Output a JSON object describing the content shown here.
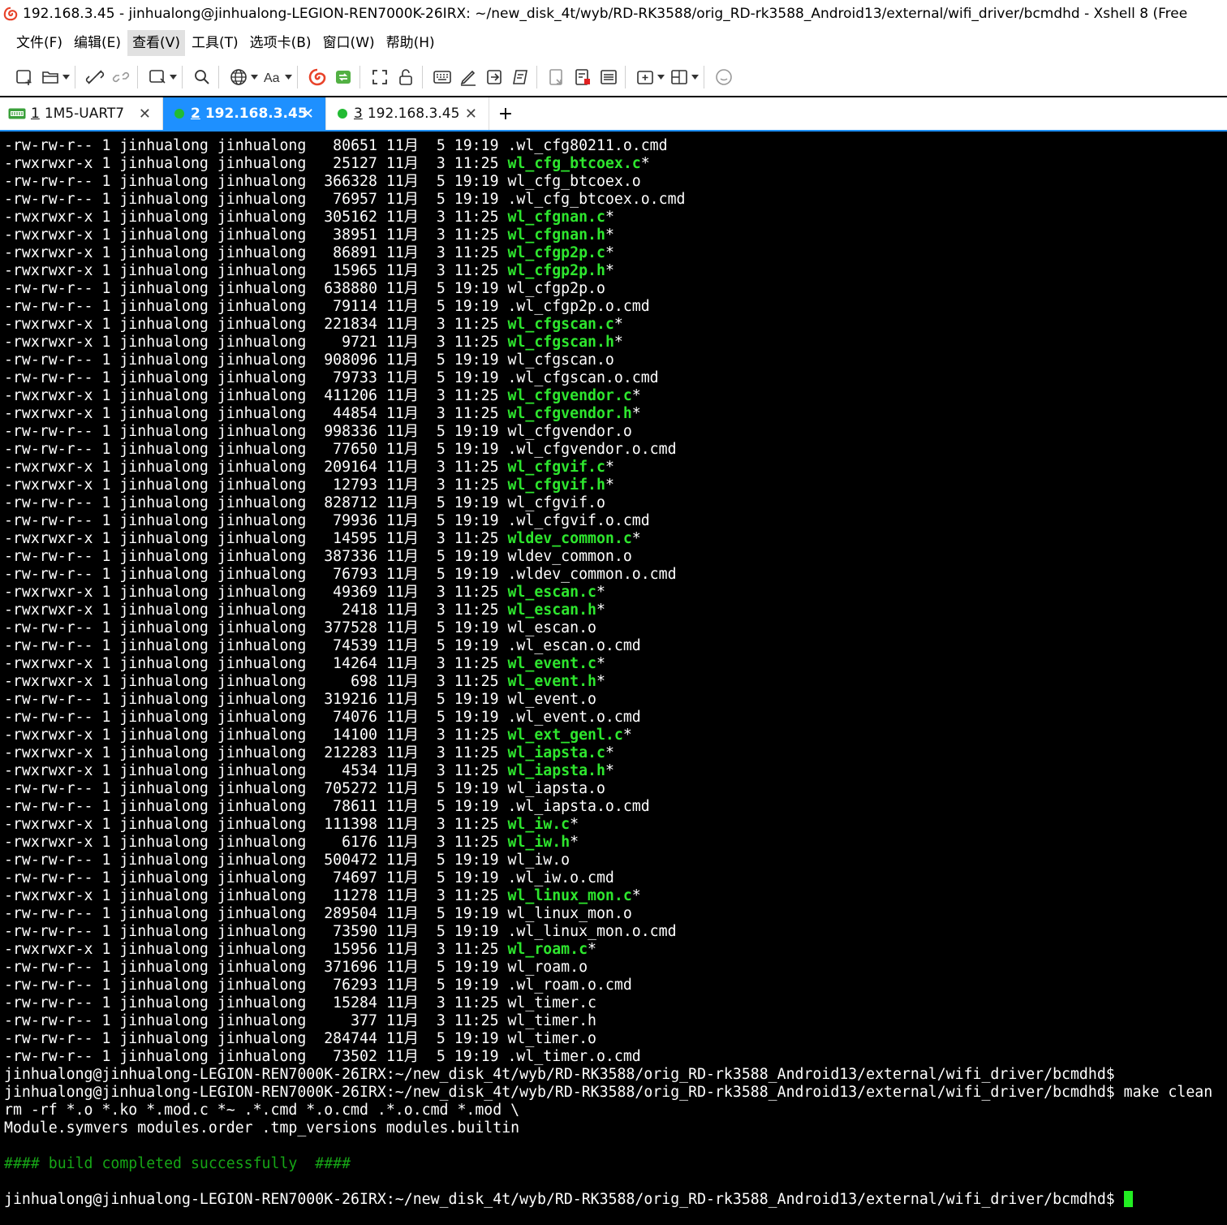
{
  "window": {
    "title": "192.168.3.45 - jinhualong@jinhualong-LEGION-REN7000K-26IRX: ~/new_disk_4t/wyb/RD-RK3588/orig_RD-rk3588_Android13/external/wifi_driver/bcmdhd - Xshell 8 (Free"
  },
  "menu": [
    "文件(F)",
    "编辑(E)",
    "查看(V)",
    "工具(T)",
    "选项卡(B)",
    "窗口(W)",
    "帮助(H)"
  ],
  "toolbar": {
    "icons": [
      "new-session-icon",
      "open-folder-icon",
      "disconnect-icon",
      "reconnect-icon",
      "new-window-icon",
      "find-icon",
      "globe-icon",
      "font-icon",
      "xshell-logo-icon",
      "xftp-icon",
      "fullscreen-icon",
      "lock-icon",
      "keyboard-icon",
      "compose-icon",
      "transfer-icon",
      "script-icon",
      "log-icon",
      "record-icon",
      "notes-icon",
      "add-tab-icon",
      "layout-icon",
      "chat-icon"
    ]
  },
  "tabs": [
    {
      "num": "1",
      "label": "1M5-UART7",
      "status": "serial",
      "active": false
    },
    {
      "num": "2",
      "label": "192.168.3.45",
      "status": "connected",
      "active": true
    },
    {
      "num": "3",
      "label": "192.168.3.45",
      "status": "connected",
      "active": false
    }
  ],
  "colors": {
    "accent": "#1e90ff",
    "executable": "#2ee62e",
    "success": "#16a516",
    "terminal_bg": "#000000"
  },
  "terminal": {
    "listing": [
      {
        "perm": "-rw-rw-r--",
        "links": "1",
        "user": "jinhualong",
        "group": "jinhualong",
        "size": "80651",
        "month": "11月",
        "day": "5",
        "time": "19:19",
        "name": ".wl_cfg80211.o.cmd",
        "exec": false
      },
      {
        "perm": "-rwxrwxr-x",
        "links": "1",
        "user": "jinhualong",
        "group": "jinhualong",
        "size": "25127",
        "month": "11月",
        "day": "3",
        "time": "11:25",
        "name": "wl_cfg_btcoex.c",
        "exec": true
      },
      {
        "perm": "-rw-rw-r--",
        "links": "1",
        "user": "jinhualong",
        "group": "jinhualong",
        "size": "366328",
        "month": "11月",
        "day": "5",
        "time": "19:19",
        "name": "wl_cfg_btcoex.o",
        "exec": false
      },
      {
        "perm": "-rw-rw-r--",
        "links": "1",
        "user": "jinhualong",
        "group": "jinhualong",
        "size": "76957",
        "month": "11月",
        "day": "5",
        "time": "19:19",
        "name": ".wl_cfg_btcoex.o.cmd",
        "exec": false
      },
      {
        "perm": "-rwxrwxr-x",
        "links": "1",
        "user": "jinhualong",
        "group": "jinhualong",
        "size": "305162",
        "month": "11月",
        "day": "3",
        "time": "11:25",
        "name": "wl_cfgnan.c",
        "exec": true
      },
      {
        "perm": "-rwxrwxr-x",
        "links": "1",
        "user": "jinhualong",
        "group": "jinhualong",
        "size": "38951",
        "month": "11月",
        "day": "3",
        "time": "11:25",
        "name": "wl_cfgnan.h",
        "exec": true
      },
      {
        "perm": "-rwxrwxr-x",
        "links": "1",
        "user": "jinhualong",
        "group": "jinhualong",
        "size": "86891",
        "month": "11月",
        "day": "3",
        "time": "11:25",
        "name": "wl_cfgp2p.c",
        "exec": true
      },
      {
        "perm": "-rwxrwxr-x",
        "links": "1",
        "user": "jinhualong",
        "group": "jinhualong",
        "size": "15965",
        "month": "11月",
        "day": "3",
        "time": "11:25",
        "name": "wl_cfgp2p.h",
        "exec": true
      },
      {
        "perm": "-rw-rw-r--",
        "links": "1",
        "user": "jinhualong",
        "group": "jinhualong",
        "size": "638880",
        "month": "11月",
        "day": "5",
        "time": "19:19",
        "name": "wl_cfgp2p.o",
        "exec": false
      },
      {
        "perm": "-rw-rw-r--",
        "links": "1",
        "user": "jinhualong",
        "group": "jinhualong",
        "size": "79114",
        "month": "11月",
        "day": "5",
        "time": "19:19",
        "name": ".wl_cfgp2p.o.cmd",
        "exec": false
      },
      {
        "perm": "-rwxrwxr-x",
        "links": "1",
        "user": "jinhualong",
        "group": "jinhualong",
        "size": "221834",
        "month": "11月",
        "day": "3",
        "time": "11:25",
        "name": "wl_cfgscan.c",
        "exec": true
      },
      {
        "perm": "-rwxrwxr-x",
        "links": "1",
        "user": "jinhualong",
        "group": "jinhualong",
        "size": "9721",
        "month": "11月",
        "day": "3",
        "time": "11:25",
        "name": "wl_cfgscan.h",
        "exec": true
      },
      {
        "perm": "-rw-rw-r--",
        "links": "1",
        "user": "jinhualong",
        "group": "jinhualong",
        "size": "908096",
        "month": "11月",
        "day": "5",
        "time": "19:19",
        "name": "wl_cfgscan.o",
        "exec": false
      },
      {
        "perm": "-rw-rw-r--",
        "links": "1",
        "user": "jinhualong",
        "group": "jinhualong",
        "size": "79733",
        "month": "11月",
        "day": "5",
        "time": "19:19",
        "name": ".wl_cfgscan.o.cmd",
        "exec": false
      },
      {
        "perm": "-rwxrwxr-x",
        "links": "1",
        "user": "jinhualong",
        "group": "jinhualong",
        "size": "411206",
        "month": "11月",
        "day": "3",
        "time": "11:25",
        "name": "wl_cfgvendor.c",
        "exec": true
      },
      {
        "perm": "-rwxrwxr-x",
        "links": "1",
        "user": "jinhualong",
        "group": "jinhualong",
        "size": "44854",
        "month": "11月",
        "day": "3",
        "time": "11:25",
        "name": "wl_cfgvendor.h",
        "exec": true
      },
      {
        "perm": "-rw-rw-r--",
        "links": "1",
        "user": "jinhualong",
        "group": "jinhualong",
        "size": "998336",
        "month": "11月",
        "day": "5",
        "time": "19:19",
        "name": "wl_cfgvendor.o",
        "exec": false
      },
      {
        "perm": "-rw-rw-r--",
        "links": "1",
        "user": "jinhualong",
        "group": "jinhualong",
        "size": "77650",
        "month": "11月",
        "day": "5",
        "time": "19:19",
        "name": ".wl_cfgvendor.o.cmd",
        "exec": false
      },
      {
        "perm": "-rwxrwxr-x",
        "links": "1",
        "user": "jinhualong",
        "group": "jinhualong",
        "size": "209164",
        "month": "11月",
        "day": "3",
        "time": "11:25",
        "name": "wl_cfgvif.c",
        "exec": true
      },
      {
        "perm": "-rwxrwxr-x",
        "links": "1",
        "user": "jinhualong",
        "group": "jinhualong",
        "size": "12793",
        "month": "11月",
        "day": "3",
        "time": "11:25",
        "name": "wl_cfgvif.h",
        "exec": true
      },
      {
        "perm": "-rw-rw-r--",
        "links": "1",
        "user": "jinhualong",
        "group": "jinhualong",
        "size": "828712",
        "month": "11月",
        "day": "5",
        "time": "19:19",
        "name": "wl_cfgvif.o",
        "exec": false
      },
      {
        "perm": "-rw-rw-r--",
        "links": "1",
        "user": "jinhualong",
        "group": "jinhualong",
        "size": "79936",
        "month": "11月",
        "day": "5",
        "time": "19:19",
        "name": ".wl_cfgvif.o.cmd",
        "exec": false
      },
      {
        "perm": "-rwxrwxr-x",
        "links": "1",
        "user": "jinhualong",
        "group": "jinhualong",
        "size": "14595",
        "month": "11月",
        "day": "3",
        "time": "11:25",
        "name": "wldev_common.c",
        "exec": true
      },
      {
        "perm": "-rw-rw-r--",
        "links": "1",
        "user": "jinhualong",
        "group": "jinhualong",
        "size": "387336",
        "month": "11月",
        "day": "5",
        "time": "19:19",
        "name": "wldev_common.o",
        "exec": false
      },
      {
        "perm": "-rw-rw-r--",
        "links": "1",
        "user": "jinhualong",
        "group": "jinhualong",
        "size": "76793",
        "month": "11月",
        "day": "5",
        "time": "19:19",
        "name": ".wldev_common.o.cmd",
        "exec": false
      },
      {
        "perm": "-rwxrwxr-x",
        "links": "1",
        "user": "jinhualong",
        "group": "jinhualong",
        "size": "49369",
        "month": "11月",
        "day": "3",
        "time": "11:25",
        "name": "wl_escan.c",
        "exec": true
      },
      {
        "perm": "-rwxrwxr-x",
        "links": "1",
        "user": "jinhualong",
        "group": "jinhualong",
        "size": "2418",
        "month": "11月",
        "day": "3",
        "time": "11:25",
        "name": "wl_escan.h",
        "exec": true
      },
      {
        "perm": "-rw-rw-r--",
        "links": "1",
        "user": "jinhualong",
        "group": "jinhualong",
        "size": "377528",
        "month": "11月",
        "day": "5",
        "time": "19:19",
        "name": "wl_escan.o",
        "exec": false
      },
      {
        "perm": "-rw-rw-r--",
        "links": "1",
        "user": "jinhualong",
        "group": "jinhualong",
        "size": "74539",
        "month": "11月",
        "day": "5",
        "time": "19:19",
        "name": ".wl_escan.o.cmd",
        "exec": false
      },
      {
        "perm": "-rwxrwxr-x",
        "links": "1",
        "user": "jinhualong",
        "group": "jinhualong",
        "size": "14264",
        "month": "11月",
        "day": "3",
        "time": "11:25",
        "name": "wl_event.c",
        "exec": true
      },
      {
        "perm": "-rwxrwxr-x",
        "links": "1",
        "user": "jinhualong",
        "group": "jinhualong",
        "size": "698",
        "month": "11月",
        "day": "3",
        "time": "11:25",
        "name": "wl_event.h",
        "exec": true
      },
      {
        "perm": "-rw-rw-r--",
        "links": "1",
        "user": "jinhualong",
        "group": "jinhualong",
        "size": "319216",
        "month": "11月",
        "day": "5",
        "time": "19:19",
        "name": "wl_event.o",
        "exec": false
      },
      {
        "perm": "-rw-rw-r--",
        "links": "1",
        "user": "jinhualong",
        "group": "jinhualong",
        "size": "74076",
        "month": "11月",
        "day": "5",
        "time": "19:19",
        "name": ".wl_event.o.cmd",
        "exec": false
      },
      {
        "perm": "-rwxrwxr-x",
        "links": "1",
        "user": "jinhualong",
        "group": "jinhualong",
        "size": "14100",
        "month": "11月",
        "day": "3",
        "time": "11:25",
        "name": "wl_ext_genl.c",
        "exec": true
      },
      {
        "perm": "-rwxrwxr-x",
        "links": "1",
        "user": "jinhualong",
        "group": "jinhualong",
        "size": "212283",
        "month": "11月",
        "day": "3",
        "time": "11:25",
        "name": "wl_iapsta.c",
        "exec": true
      },
      {
        "perm": "-rwxrwxr-x",
        "links": "1",
        "user": "jinhualong",
        "group": "jinhualong",
        "size": "4534",
        "month": "11月",
        "day": "3",
        "time": "11:25",
        "name": "wl_iapsta.h",
        "exec": true
      },
      {
        "perm": "-rw-rw-r--",
        "links": "1",
        "user": "jinhualong",
        "group": "jinhualong",
        "size": "705272",
        "month": "11月",
        "day": "5",
        "time": "19:19",
        "name": "wl_iapsta.o",
        "exec": false
      },
      {
        "perm": "-rw-rw-r--",
        "links": "1",
        "user": "jinhualong",
        "group": "jinhualong",
        "size": "78611",
        "month": "11月",
        "day": "5",
        "time": "19:19",
        "name": ".wl_iapsta.o.cmd",
        "exec": false
      },
      {
        "perm": "-rwxrwxr-x",
        "links": "1",
        "user": "jinhualong",
        "group": "jinhualong",
        "size": "111398",
        "month": "11月",
        "day": "3",
        "time": "11:25",
        "name": "wl_iw.c",
        "exec": true
      },
      {
        "perm": "-rwxrwxr-x",
        "links": "1",
        "user": "jinhualong",
        "group": "jinhualong",
        "size": "6176",
        "month": "11月",
        "day": "3",
        "time": "11:25",
        "name": "wl_iw.h",
        "exec": true
      },
      {
        "perm": "-rw-rw-r--",
        "links": "1",
        "user": "jinhualong",
        "group": "jinhualong",
        "size": "500472",
        "month": "11月",
        "day": "5",
        "time": "19:19",
        "name": "wl_iw.o",
        "exec": false
      },
      {
        "perm": "-rw-rw-r--",
        "links": "1",
        "user": "jinhualong",
        "group": "jinhualong",
        "size": "74697",
        "month": "11月",
        "day": "5",
        "time": "19:19",
        "name": ".wl_iw.o.cmd",
        "exec": false
      },
      {
        "perm": "-rwxrwxr-x",
        "links": "1",
        "user": "jinhualong",
        "group": "jinhualong",
        "size": "11278",
        "month": "11月",
        "day": "3",
        "time": "11:25",
        "name": "wl_linux_mon.c",
        "exec": true
      },
      {
        "perm": "-rw-rw-r--",
        "links": "1",
        "user": "jinhualong",
        "group": "jinhualong",
        "size": "289504",
        "month": "11月",
        "day": "5",
        "time": "19:19",
        "name": "wl_linux_mon.o",
        "exec": false
      },
      {
        "perm": "-rw-rw-r--",
        "links": "1",
        "user": "jinhualong",
        "group": "jinhualong",
        "size": "73590",
        "month": "11月",
        "day": "5",
        "time": "19:19",
        "name": ".wl_linux_mon.o.cmd",
        "exec": false
      },
      {
        "perm": "-rwxrwxr-x",
        "links": "1",
        "user": "jinhualong",
        "group": "jinhualong",
        "size": "15956",
        "month": "11月",
        "day": "3",
        "time": "11:25",
        "name": "wl_roam.c",
        "exec": true
      },
      {
        "perm": "-rw-rw-r--",
        "links": "1",
        "user": "jinhualong",
        "group": "jinhualong",
        "size": "371696",
        "month": "11月",
        "day": "5",
        "time": "19:19",
        "name": "wl_roam.o",
        "exec": false
      },
      {
        "perm": "-rw-rw-r--",
        "links": "1",
        "user": "jinhualong",
        "group": "jinhualong",
        "size": "76293",
        "month": "11月",
        "day": "5",
        "time": "19:19",
        "name": ".wl_roam.o.cmd",
        "exec": false
      },
      {
        "perm": "-rw-rw-r--",
        "links": "1",
        "user": "jinhualong",
        "group": "jinhualong",
        "size": "15284",
        "month": "11月",
        "day": "3",
        "time": "11:25",
        "name": "wl_timer.c",
        "exec": false
      },
      {
        "perm": "-rw-rw-r--",
        "links": "1",
        "user": "jinhualong",
        "group": "jinhualong",
        "size": "377",
        "month": "11月",
        "day": "3",
        "time": "11:25",
        "name": "wl_timer.h",
        "exec": false
      },
      {
        "perm": "-rw-rw-r--",
        "links": "1",
        "user": "jinhualong",
        "group": "jinhualong",
        "size": "284744",
        "month": "11月",
        "day": "5",
        "time": "19:19",
        "name": "wl_timer.o",
        "exec": false
      },
      {
        "perm": "-rw-rw-r--",
        "links": "1",
        "user": "jinhualong",
        "group": "jinhualong",
        "size": "73502",
        "month": "11月",
        "day": "5",
        "time": "19:19",
        "name": ".wl_timer.o.cmd",
        "exec": false
      }
    ],
    "tail": [
      {
        "text": "jinhualong@jinhualong-LEGION-REN7000K-26IRX:~/new_disk_4t/wyb/RD-RK3588/orig_RD-rk3588_Android13/external/wifi_driver/bcmdhd$",
        "style": "normal"
      },
      {
        "text": "jinhualong@jinhualong-LEGION-REN7000K-26IRX:~/new_disk_4t/wyb/RD-RK3588/orig_RD-rk3588_Android13/external/wifi_driver/bcmdhd$ make clean",
        "style": "normal"
      },
      {
        "text": "rm -rf *.o *.ko *.mod.c *~ .*.cmd *.o.cmd .*.o.cmd *.mod \\",
        "style": "normal"
      },
      {
        "text": "Module.symvers modules.order .tmp_versions modules.builtin",
        "style": "normal"
      },
      {
        "text": "",
        "style": "normal"
      },
      {
        "text": "#### build completed successfully  ####",
        "style": "success"
      },
      {
        "text": "",
        "style": "normal"
      },
      {
        "text": "jinhualong@jinhualong-LEGION-REN7000K-26IRX:~/new_disk_4t/wyb/RD-RK3588/orig_RD-rk3588_Android13/external/wifi_driver/bcmdhd$ ",
        "style": "prompt-cursor"
      }
    ]
  }
}
